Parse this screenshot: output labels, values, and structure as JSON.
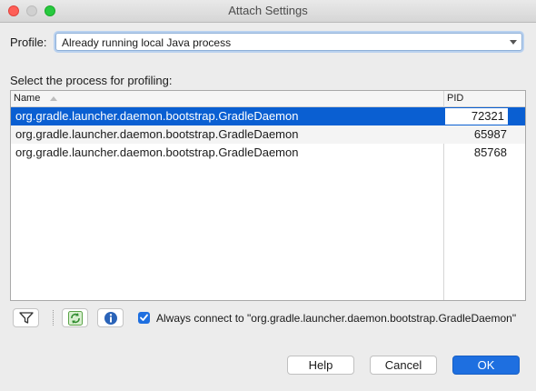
{
  "window": {
    "title": "Attach Settings"
  },
  "profile": {
    "label": "Profile:",
    "value": "Already running local Java process"
  },
  "process_section": {
    "label": "Select the process for profiling:",
    "columns": [
      "Name",
      "PID"
    ],
    "rows": [
      {
        "name": "org.gradle.launcher.daemon.bootstrap.GradleDaemon",
        "pid": "72321",
        "selected": true
      },
      {
        "name": "org.gradle.launcher.daemon.bootstrap.GradleDaemon",
        "pid": "65987",
        "selected": false
      },
      {
        "name": "org.gradle.launcher.daemon.bootstrap.GradleDaemon",
        "pid": "85768",
        "selected": false
      }
    ]
  },
  "toolbar": {
    "icons": [
      "filter-icon",
      "refresh-icon",
      "info-icon"
    ]
  },
  "always_connect": {
    "checked": true,
    "label": "Always connect to \"org.gradle.launcher.daemon.bootstrap.GradleDaemon\""
  },
  "buttons": {
    "help": "Help",
    "cancel": "Cancel",
    "ok": "OK"
  },
  "colors": {
    "selection": "#0a5fd2",
    "accent": "#1e6fe0"
  }
}
